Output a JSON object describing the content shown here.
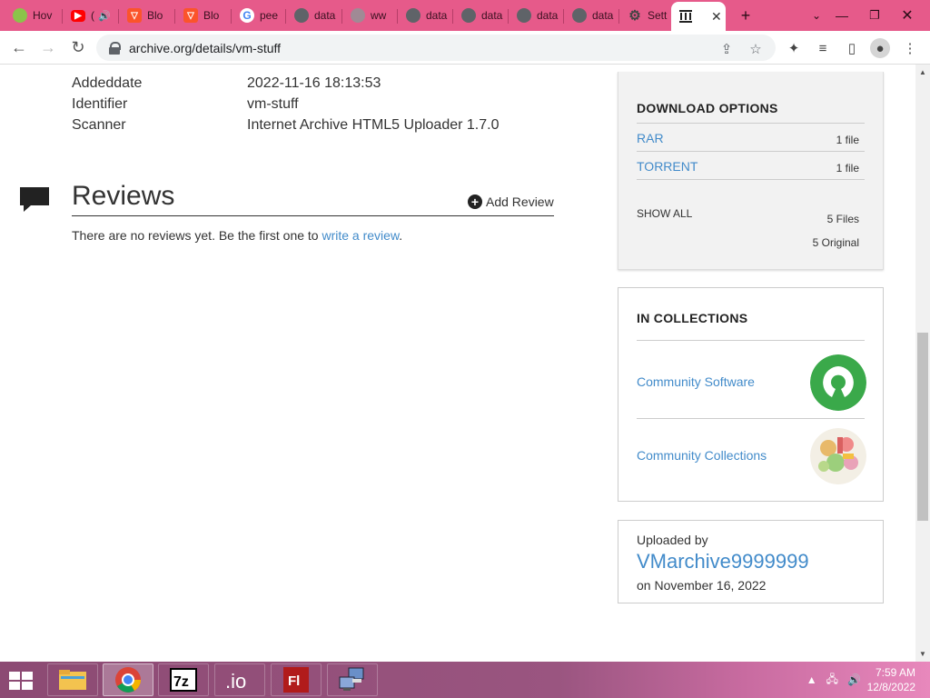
{
  "browser": {
    "tabs": [
      {
        "title": "Hov",
        "favicon": "food-favicon",
        "color": "#8bc34a"
      },
      {
        "title": "(",
        "favicon": "youtube-favicon",
        "color": "#ff0000"
      },
      {
        "title": "Blo",
        "favicon": "brave-favicon",
        "color": "#fb542b"
      },
      {
        "title": "Blo",
        "favicon": "brave-favicon",
        "color": "#fb542b"
      },
      {
        "title": "pee",
        "favicon": "google-favicon",
        "color": "#4285f4"
      },
      {
        "title": "data",
        "favicon": "globe-favicon",
        "color": "#5f6368"
      },
      {
        "title": "ww",
        "favicon": "globe-favicon",
        "color": "#a08a95"
      },
      {
        "title": "data",
        "favicon": "globe-favicon",
        "color": "#5f6368"
      },
      {
        "title": "data",
        "favicon": "globe-favicon",
        "color": "#5f6368"
      },
      {
        "title": "data",
        "favicon": "globe-favicon",
        "color": "#5f6368"
      },
      {
        "title": "data",
        "favicon": "globe-favicon",
        "color": "#5f6368"
      },
      {
        "title": "Sett",
        "favicon": "gear-favicon",
        "color": "#5f6368"
      }
    ],
    "active_tab_title": "",
    "url": "archive.org/details/vm-stuff"
  },
  "metadata": [
    {
      "label": "Addeddate",
      "value": "2022-11-16 18:13:53"
    },
    {
      "label": "Identifier",
      "value": "vm-stuff"
    },
    {
      "label": "Scanner",
      "value": "Internet Archive HTML5 Uploader 1.7.0"
    }
  ],
  "reviews": {
    "title": "Reviews",
    "add_label": "Add Review",
    "empty_text": "There are no reviews yet. Be the first one to ",
    "write_link": "write a review",
    "empty_suffix": "."
  },
  "download": {
    "heading": "DOWNLOAD OPTIONS",
    "items": [
      {
        "label": "RAR",
        "count": "1 file"
      },
      {
        "label": "TORRENT",
        "count": "1 file"
      }
    ],
    "show_all": "SHOW ALL",
    "files_total": "5 Files",
    "original_total": "5 Original"
  },
  "collections": {
    "heading": "IN COLLECTIONS",
    "items": [
      {
        "label": "Community Software"
      },
      {
        "label": "Community Collections"
      }
    ]
  },
  "uploader": {
    "label": "Uploaded by",
    "name": "VMarchive9999999",
    "date": "on November 16, 2022"
  },
  "taskbar": {
    "apps": [
      "file-explorer",
      "chrome",
      "7zip",
      "io-app",
      "flash",
      "network-app"
    ],
    "time": "7:59 AM",
    "date": "12/8/2022"
  },
  "colors": {
    "tabstrip": "#e65a8a",
    "link": "#428bca"
  }
}
